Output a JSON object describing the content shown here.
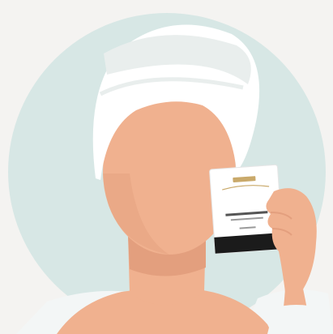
{
  "illustration": {
    "subject": "woman-with-towel-holding-sachet",
    "colors": {
      "page_background": "#f4f3f1",
      "circle_background": "#d7e7e5",
      "skin": "#f0b18f",
      "skin_shadow": "#e39f7e",
      "towel": "#ffffff",
      "towel_shadow": "#e9eeed",
      "robe": "#f3f6f6",
      "sachet_white": "#ffffff",
      "sachet_band": "#1b1b1b",
      "sachet_gold": "#c9a96a"
    }
  },
  "sachet": {
    "brand": "",
    "product_name": "",
    "product_sub": "",
    "volume": ""
  }
}
